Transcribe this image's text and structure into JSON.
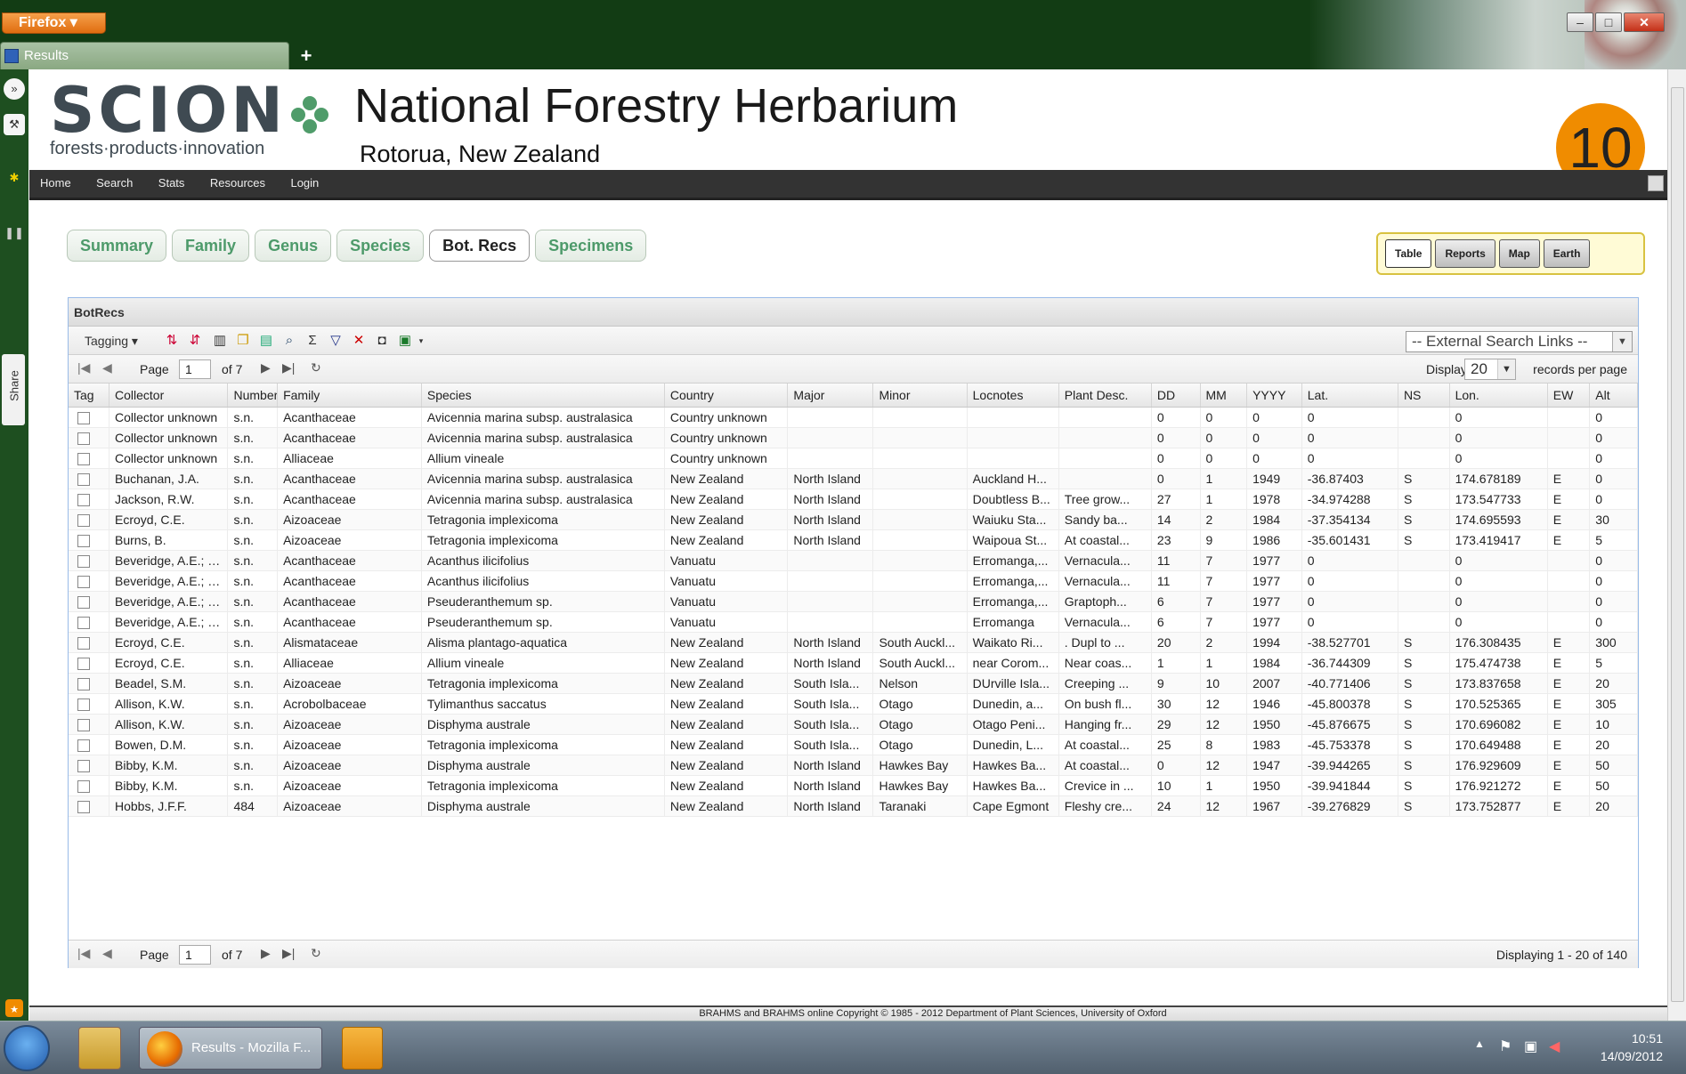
{
  "browser": {
    "menu_label": "Firefox ▾",
    "tab_title": "Results",
    "new_tab": "+",
    "minimize": "–",
    "maximize": "□",
    "close": "✕"
  },
  "sidebar": {
    "share_label": "Share"
  },
  "header": {
    "logo_word": "SCION",
    "logo_tagline": "forests·products·innovation",
    "title": "National Forestry Herbarium",
    "subtitle": "Rotorua, New Zealand",
    "badge": "10"
  },
  "nav": [
    "Home",
    "Search",
    "Stats",
    "Resources",
    "Login"
  ],
  "page_tabs": [
    "Summary",
    "Family",
    "Genus",
    "Species",
    "Bot. Recs",
    "Specimens"
  ],
  "active_tab": "Bot. Recs",
  "view_buttons": [
    "Table",
    "Reports",
    "Map",
    "Earth"
  ],
  "grid": {
    "title": "BotRecs",
    "tagging_label": "Tagging ▾",
    "external_links": "-- External Search Links --",
    "pager": {
      "page_label": "Page",
      "page": "1",
      "of": "of 7",
      "display_label": "Display",
      "per_page": "20",
      "per_page_suffix": "records per page",
      "summary": "Displaying 1 - 20 of 140"
    },
    "columns": [
      "Tag",
      "Collector",
      "Number",
      "Family",
      "Species",
      "Country",
      "Major",
      "Minor",
      "Locnotes",
      "Plant Desc.",
      "DD",
      "MM",
      "YYYY",
      "Lat.",
      "NS",
      "Lon.",
      "EW",
      "Alt"
    ],
    "rows": [
      [
        "",
        "Collector unknown",
        "s.n.",
        "Acanthaceae",
        "Avicennia marina subsp. australasica",
        "Country unknown",
        "",
        "",
        "",
        "",
        "0",
        "0",
        "0",
        "0",
        "",
        "0",
        "",
        "0"
      ],
      [
        "",
        "Collector unknown",
        "s.n.",
        "Acanthaceae",
        "Avicennia marina subsp. australasica",
        "Country unknown",
        "",
        "",
        "",
        "",
        "0",
        "0",
        "0",
        "0",
        "",
        "0",
        "",
        "0"
      ],
      [
        "",
        "Collector unknown",
        "s.n.",
        "Alliaceae",
        "Allium vineale",
        "Country unknown",
        "",
        "",
        "",
        "",
        "0",
        "0",
        "0",
        "0",
        "",
        "0",
        "",
        "0"
      ],
      [
        "",
        "Buchanan, J.A.",
        "s.n.",
        "Acanthaceae",
        "Avicennia marina subsp. australasica",
        "New Zealand",
        "North Island",
        "",
        "Auckland H...",
        "",
        "0",
        "1",
        "1949",
        "-36.87403",
        "S",
        "174.678189",
        "E",
        "0"
      ],
      [
        "",
        "Jackson, R.W.",
        "s.n.",
        "Acanthaceae",
        "Avicennia marina subsp. australasica",
        "New Zealand",
        "North Island",
        "",
        "Doubtless B...",
        "Tree grow...",
        "27",
        "1",
        "1978",
        "-34.974288",
        "S",
        "173.547733",
        "E",
        "0"
      ],
      [
        "",
        "Ecroyd, C.E.",
        "s.n.",
        "Aizoaceae",
        "Tetragonia implexicoma",
        "New Zealand",
        "North Island",
        "",
        "Waiuku Sta...",
        "Sandy ba...",
        "14",
        "2",
        "1984",
        "-37.354134",
        "S",
        "174.695593",
        "E",
        "30"
      ],
      [
        "",
        "Burns, B.",
        "s.n.",
        "Aizoaceae",
        "Tetragonia implexicoma",
        "New Zealand",
        "North Island",
        "",
        "Waipoua St...",
        "At coastal...",
        "23",
        "9",
        "1986",
        "-35.601431",
        "S",
        "173.419417",
        "E",
        "5"
      ],
      [
        "",
        "Beveridge, A.E.; Mit...",
        "s.n.",
        "Acanthaceae",
        "Acanthus ilicifolius",
        "Vanuatu",
        "",
        "",
        "Erromanga,...",
        "Vernacula...",
        "11",
        "7",
        "1977",
        "0",
        "",
        "0",
        "",
        "0"
      ],
      [
        "",
        "Beveridge, A.E.; Ecr...",
        "s.n.",
        "Acanthaceae",
        "Acanthus ilicifolius",
        "Vanuatu",
        "",
        "",
        "Erromanga,...",
        "Vernacula...",
        "11",
        "7",
        "1977",
        "0",
        "",
        "0",
        "",
        "0"
      ],
      [
        "",
        "Beveridge, A.E.; Ecr...",
        "s.n.",
        "Acanthaceae",
        "Pseuderanthemum sp.",
        "Vanuatu",
        "",
        "",
        "Erromanga,...",
        "Graptoph...",
        "6",
        "7",
        "1977",
        "0",
        "",
        "0",
        "",
        "0"
      ],
      [
        "",
        "Beveridge, A.E.; Ecr...",
        "s.n.",
        "Acanthaceae",
        "Pseuderanthemum sp.",
        "Vanuatu",
        "",
        "",
        "Erromanga",
        "Vernacula...",
        "6",
        "7",
        "1977",
        "0",
        "",
        "0",
        "",
        "0"
      ],
      [
        "",
        "Ecroyd, C.E.",
        "s.n.",
        "Alismataceae",
        "Alisma plantago-aquatica",
        "New Zealand",
        "North Island",
        "South Auckl...",
        "Waikato Ri...",
        ". Dupl to ...",
        "20",
        "2",
        "1994",
        "-38.527701",
        "S",
        "176.308435",
        "E",
        "300"
      ],
      [
        "",
        "Ecroyd, C.E.",
        "s.n.",
        "Alliaceae",
        "Allium vineale",
        "New Zealand",
        "North Island",
        "South Auckl...",
        "near Corom...",
        "Near coas...",
        "1",
        "1",
        "1984",
        "-36.744309",
        "S",
        "175.474738",
        "E",
        "5"
      ],
      [
        "",
        "Beadel, S.M.",
        "s.n.",
        "Aizoaceae",
        "Tetragonia implexicoma",
        "New Zealand",
        "South Isla...",
        "Nelson",
        "DUrville Isla...",
        "Creeping ...",
        "9",
        "10",
        "2007",
        "-40.771406",
        "S",
        "173.837658",
        "E",
        "20"
      ],
      [
        "",
        "Allison, K.W.",
        "s.n.",
        "Acrobolbaceae",
        "Tylimanthus saccatus",
        "New Zealand",
        "South Isla...",
        "Otago",
        "Dunedin, a...",
        "On bush fl...",
        "30",
        "12",
        "1946",
        "-45.800378",
        "S",
        "170.525365",
        "E",
        "305"
      ],
      [
        "",
        "Allison, K.W.",
        "s.n.",
        "Aizoaceae",
        "Disphyma australe",
        "New Zealand",
        "South Isla...",
        "Otago",
        "Otago Peni...",
        "Hanging fr...",
        "29",
        "12",
        "1950",
        "-45.876675",
        "S",
        "170.696082",
        "E",
        "10"
      ],
      [
        "",
        "Bowen, D.M.",
        "s.n.",
        "Aizoaceae",
        "Tetragonia implexicoma",
        "New Zealand",
        "South Isla...",
        "Otago",
        "Dunedin, L...",
        "At coastal...",
        "25",
        "8",
        "1983",
        "-45.753378",
        "S",
        "170.649488",
        "E",
        "20"
      ],
      [
        "",
        "Bibby, K.M.",
        "s.n.",
        "Aizoaceae",
        "Disphyma australe",
        "New Zealand",
        "North Island",
        "Hawkes Bay",
        "Hawkes Ba...",
        "At coastal...",
        "0",
        "12",
        "1947",
        "-39.944265",
        "S",
        "176.929609",
        "E",
        "50"
      ],
      [
        "",
        "Bibby, K.M.",
        "s.n.",
        "Aizoaceae",
        "Tetragonia implexicoma",
        "New Zealand",
        "North Island",
        "Hawkes Bay",
        "Hawkes Ba...",
        "Crevice in ...",
        "10",
        "1",
        "1950",
        "-39.941844",
        "S",
        "176.921272",
        "E",
        "50"
      ],
      [
        "",
        "Hobbs, J.F.F.",
        "484",
        "Aizoaceae",
        "Disphyma australe",
        "New Zealand",
        "North Island",
        "Taranaki",
        "Cape Egmont",
        "Fleshy cre...",
        "24",
        "12",
        "1967",
        "-39.276829",
        "S",
        "173.752877",
        "E",
        "20"
      ]
    ]
  },
  "footer": "BRAHMS and BRAHMS online Copyright © 1985 - 2012 Department of Plant Sciences, University of Oxford",
  "taskbar": {
    "firefox_task": "Results - Mozilla F...",
    "time": "10:51",
    "date": "14/09/2012"
  }
}
